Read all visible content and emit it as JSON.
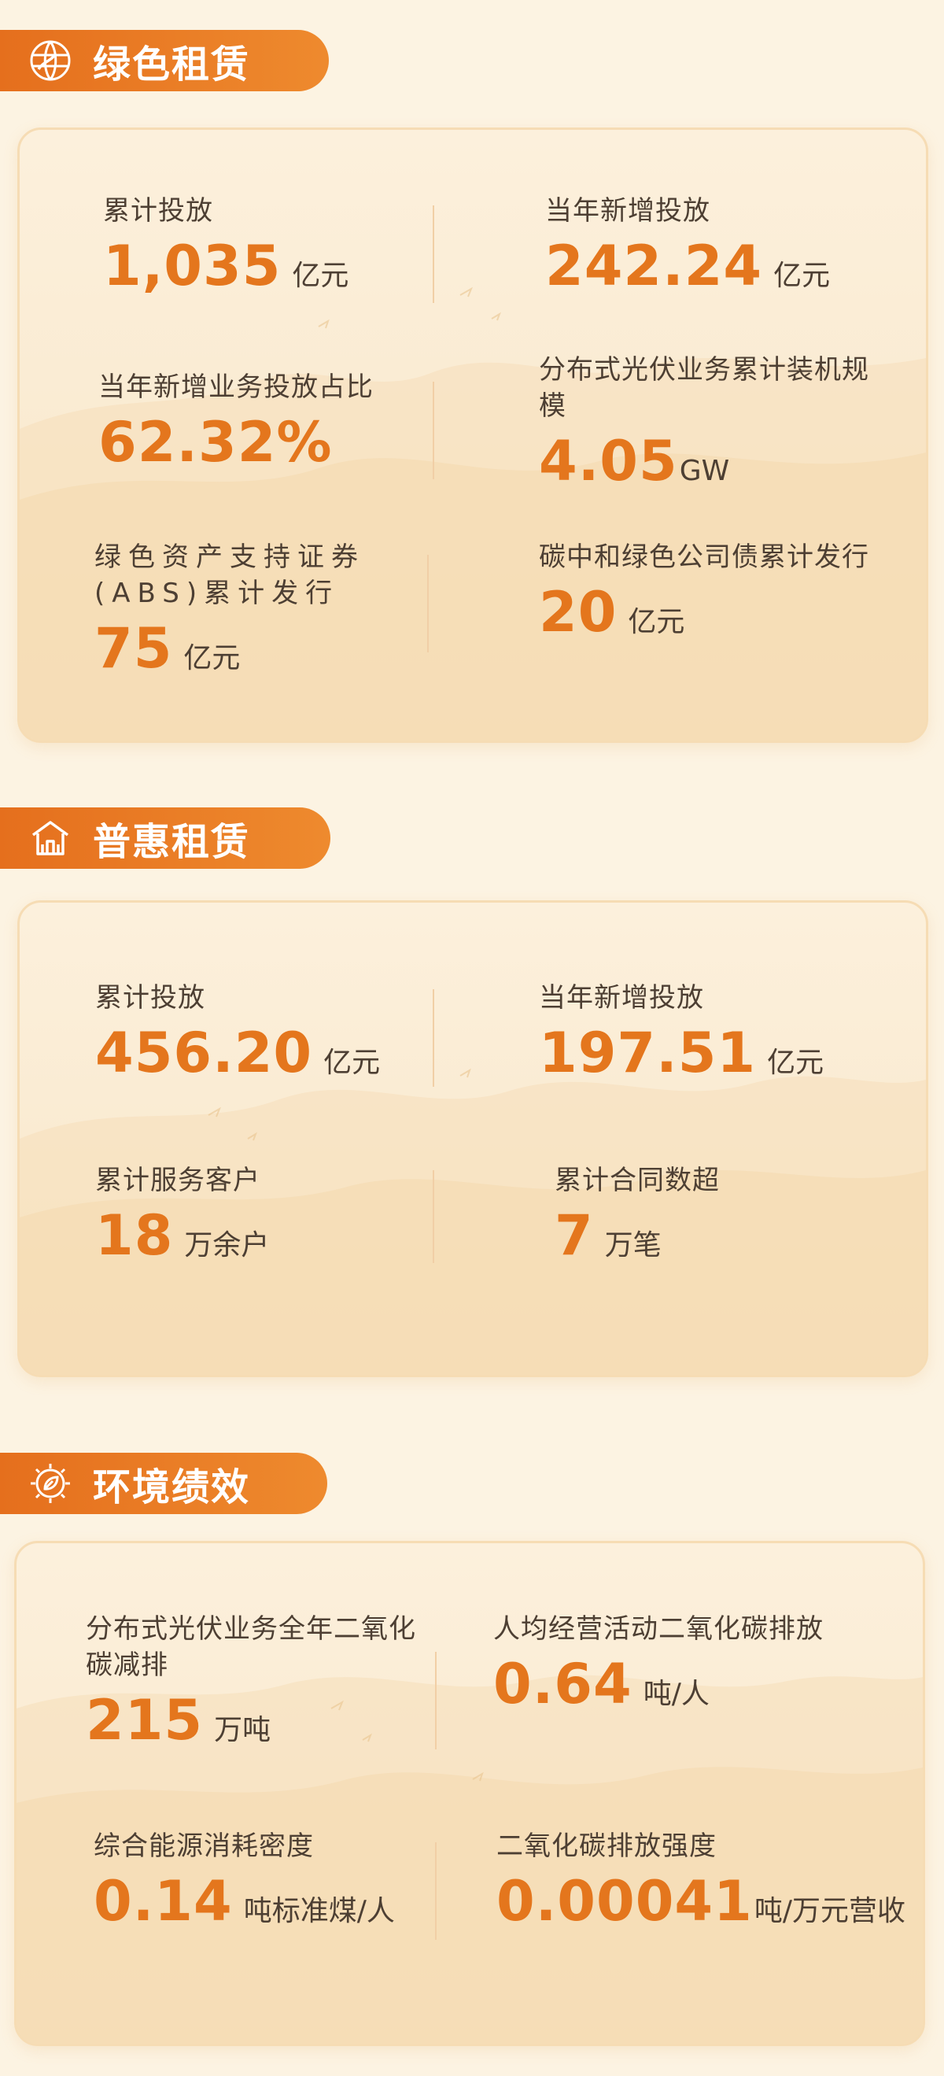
{
  "colors": {
    "accent": "#e4761d",
    "header": "#e9792a",
    "background": "#fcf3e2"
  },
  "sections": [
    {
      "title": "绿色租赁",
      "icon": "globe-leaf-icon",
      "stats": [
        {
          "label": "累计投放",
          "value": "1,035",
          "unit": "亿元"
        },
        {
          "label": "当年新增投放",
          "value": "242.24",
          "unit": "亿元"
        },
        {
          "label": "当年新增业务投放占比",
          "value": "62.32%",
          "unit": ""
        },
        {
          "label": "分布式光伏业务累计装机规模",
          "value": "4.05",
          "unit": "GW"
        },
        {
          "label": "绿色资产支持证券(ABS)累计发行",
          "value": "75",
          "unit": "亿元"
        },
        {
          "label": "碳中和绿色公司债累计发行",
          "value": "20",
          "unit": "亿元"
        }
      ]
    },
    {
      "title": "普惠租赁",
      "icon": "house-icon",
      "stats": [
        {
          "label": "累计投放",
          "value": "456.20",
          "unit": "亿元"
        },
        {
          "label": "当年新增投放",
          "value": "197.51",
          "unit": "亿元"
        },
        {
          "label": "累计服务客户",
          "value": "18",
          "unit": "万余户"
        },
        {
          "label": "累计合同数超",
          "value": "7",
          "unit": "万笔"
        }
      ]
    },
    {
      "title": "环境绩效",
      "icon": "gear-leaf-icon",
      "stats": [
        {
          "label": "分布式光伏业务全年二氧化碳减排",
          "value": "215",
          "unit": "万吨"
        },
        {
          "label": "人均经营活动二氧化碳排放",
          "value": "0.64",
          "unit": "吨/人"
        },
        {
          "label": "综合能源消耗密度",
          "value": "0.14",
          "unit": "吨标准煤/人"
        },
        {
          "label": "二氧化碳排放强度",
          "value": "0.00041",
          "unit": "吨/万元营收"
        }
      ]
    }
  ]
}
